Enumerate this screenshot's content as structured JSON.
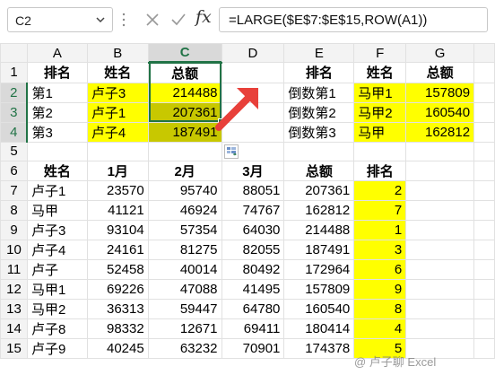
{
  "formula_bar": {
    "name_box": "C2",
    "fx_label": "fx",
    "formula": "=LARGE($E$7:$E$15,ROW(A1))"
  },
  "columns": [
    "A",
    "B",
    "C",
    "D",
    "E",
    "F",
    "G"
  ],
  "selected_column": "C",
  "rows": [
    {
      "n": "1",
      "cells": [
        "排名",
        "姓名",
        "总额",
        "",
        "排名",
        "姓名",
        "总额"
      ]
    },
    {
      "n": "2",
      "cells": [
        "第1",
        "卢子3",
        "214488",
        "",
        "倒数第1",
        "马甲1",
        "157809"
      ]
    },
    {
      "n": "3",
      "cells": [
        "第2",
        "卢子1",
        "207361",
        "",
        "倒数第2",
        "马甲2",
        "160540"
      ]
    },
    {
      "n": "4",
      "cells": [
        "第3",
        "卢子4",
        "187491",
        "",
        "倒数第3",
        "马甲",
        "162812"
      ]
    },
    {
      "n": "5",
      "cells": [
        "",
        "",
        "",
        "",
        "",
        "",
        ""
      ]
    },
    {
      "n": "6",
      "cells": [
        "姓名",
        "1月",
        "2月",
        "3月",
        "总额",
        "排名",
        ""
      ]
    },
    {
      "n": "7",
      "cells": [
        "卢子1",
        "23570",
        "95740",
        "88051",
        "207361",
        "2",
        ""
      ]
    },
    {
      "n": "8",
      "cells": [
        "马甲",
        "41121",
        "46924",
        "74767",
        "162812",
        "7",
        ""
      ]
    },
    {
      "n": "9",
      "cells": [
        "卢子3",
        "93104",
        "57354",
        "64030",
        "214488",
        "1",
        ""
      ]
    },
    {
      "n": "10",
      "cells": [
        "卢子4",
        "24161",
        "81275",
        "82055",
        "187491",
        "3",
        ""
      ]
    },
    {
      "n": "11",
      "cells": [
        "卢子",
        "52458",
        "40014",
        "80492",
        "172964",
        "6",
        ""
      ]
    },
    {
      "n": "12",
      "cells": [
        "马甲1",
        "69226",
        "47088",
        "41495",
        "157809",
        "9",
        ""
      ]
    },
    {
      "n": "13",
      "cells": [
        "马甲2",
        "36313",
        "59447",
        "64780",
        "160540",
        "8",
        ""
      ]
    },
    {
      "n": "14",
      "cells": [
        "卢子8",
        "98332",
        "12671",
        "69411",
        "180414",
        "4",
        ""
      ]
    },
    {
      "n": "15",
      "cells": [
        "卢子9",
        "40245",
        "63232",
        "70901",
        "174378",
        "5",
        ""
      ]
    }
  ],
  "colors": {
    "highlight": "#ffff00",
    "selected_highlight": "#c8c800",
    "selection_border": "#217346",
    "arrow": "#e8403a"
  },
  "icons": [
    "cancel-icon",
    "enter-icon",
    "fx-icon",
    "quick-analysis-icon",
    "chevron-down-icon"
  ],
  "watermark": "@ 卢子聊 Excel"
}
